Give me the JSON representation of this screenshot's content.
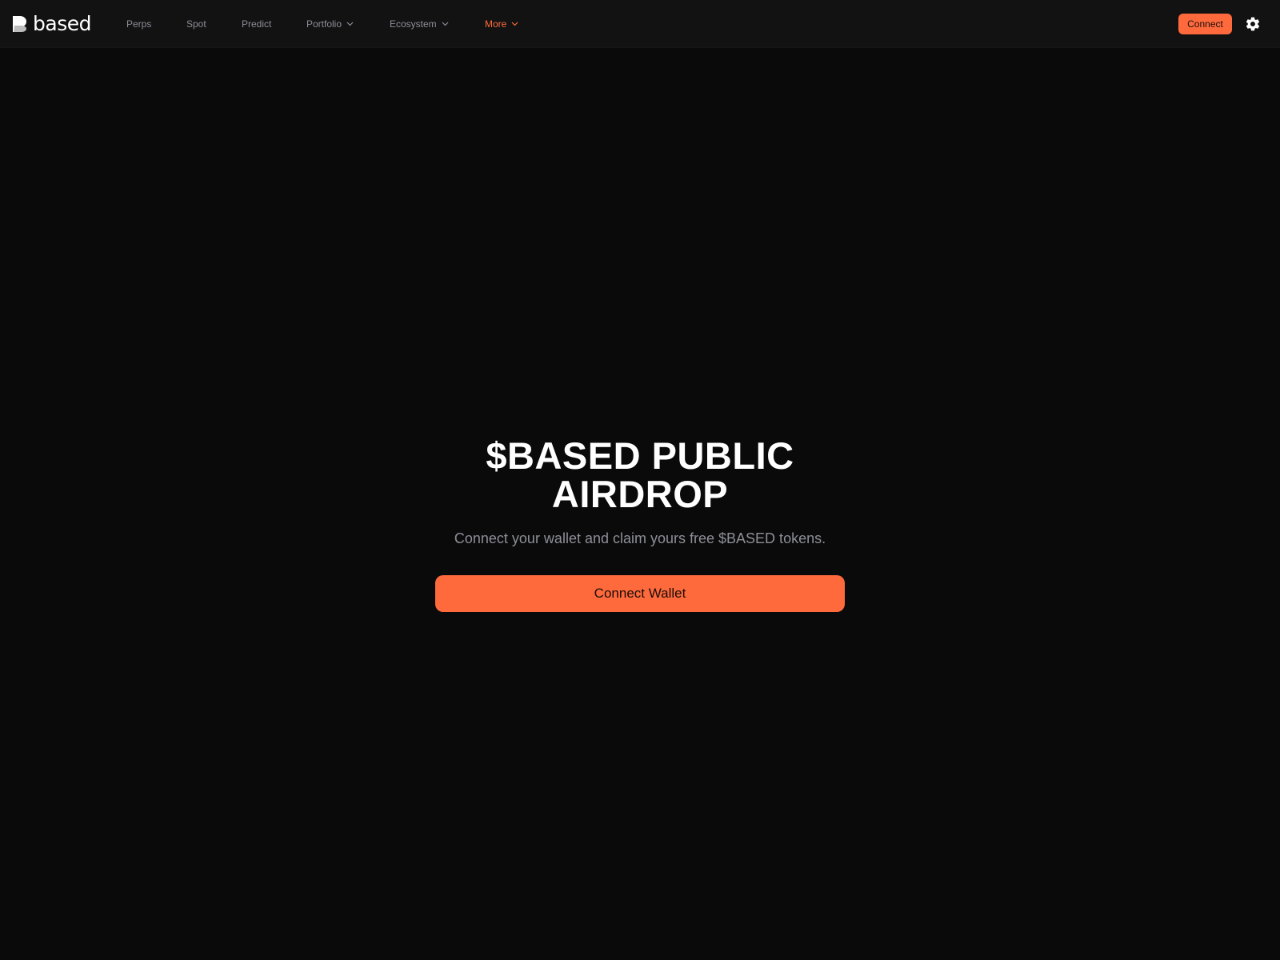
{
  "brand": {
    "name": "based",
    "accent_color": "#ff6a3d",
    "background_color": "#0a0a0a"
  },
  "nav": {
    "items": [
      {
        "label": "Perps"
      },
      {
        "label": "Spot"
      },
      {
        "label": "Predict"
      },
      {
        "label": "Portfolio",
        "icon": "chevron-down-icon"
      },
      {
        "label": "Ecosystem",
        "icon": "chevron-down-icon"
      },
      {
        "label": "More",
        "icon": "chevron-down-icon",
        "active": true
      }
    ]
  },
  "header": {
    "connect_label": "Connect",
    "settings_icon": "gear-icon"
  },
  "hero": {
    "title": "$BASED PUBLIC AIRDROP",
    "subtitle": "Connect your wallet and claim yours free $BASED tokens.",
    "cta_label": "Connect Wallet"
  }
}
